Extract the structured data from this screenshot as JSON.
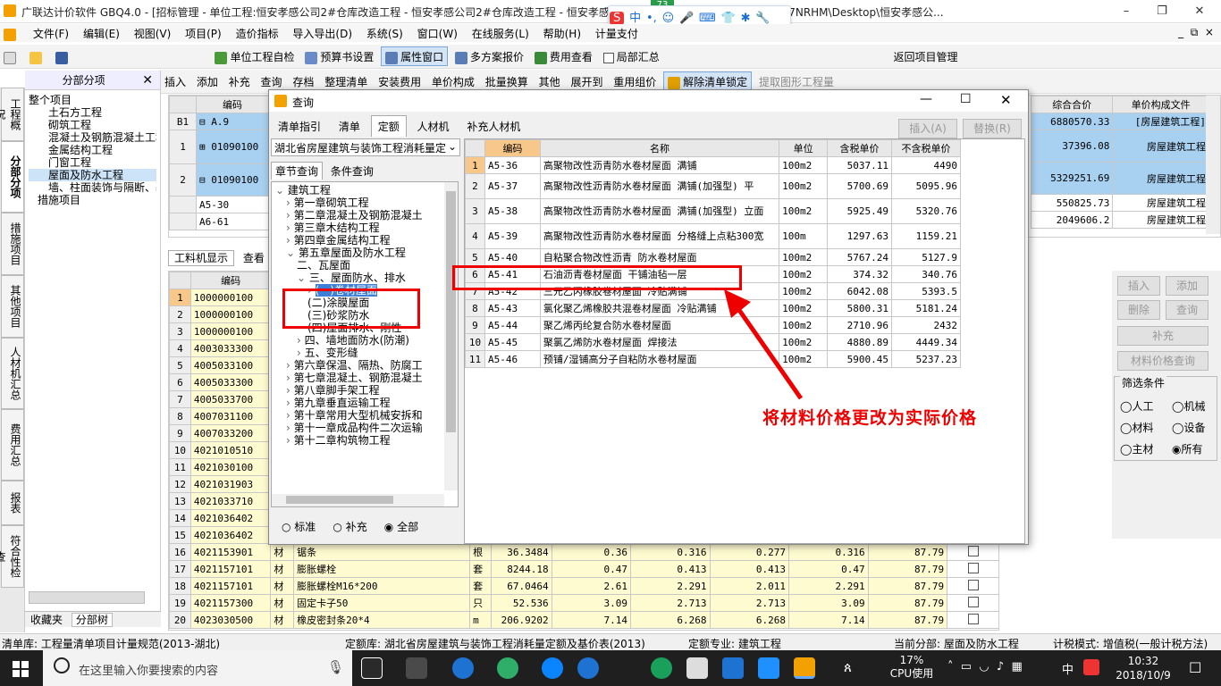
{
  "window": {
    "title": "广联达计价软件 GBQ4.0 - [招标管理 - 单位工程:恒安孝感公司2#仓库改造工程 - 恒安孝感公司2#仓库改造工程 - 恒安孝感公 ...rs\\Administrator.PC-20141127NRHM\\Desktop\\恒安孝感公...",
    "minimize": "–",
    "restore": "❐",
    "close": "✕",
    "badge": "73"
  },
  "ime": {
    "logo": "S",
    "label": "中"
  },
  "menu": [
    "文件(F)",
    "编辑(E)",
    "视图(V)",
    "项目(P)",
    "造价指标",
    "导入导出(D)",
    "系统(S)",
    "窗口(W)",
    "在线服务(L)",
    "帮助(H)",
    "计量支付"
  ],
  "toolbar1": {
    "check": "单位工程自检",
    "budget": "预算书设置",
    "attr": "属性窗口",
    "multi": "多方案报价",
    "fee": "费用查看",
    "local": "局部汇总",
    "back": "返回项目管理"
  },
  "toolbar2": {
    "items": [
      "插入",
      "添加",
      "补充",
      "查询",
      "存档",
      "整理清单",
      "安装费用",
      "单价构成",
      "批量换算",
      "其他",
      "展开到",
      "重用组价",
      "解除清单锁定",
      "提取图形工程量"
    ]
  },
  "lefttabs": [
    "工程概况",
    "分部分项",
    "措施项目",
    "其他项目",
    "人材机汇总",
    "费用汇总",
    "报表",
    "符合性检查"
  ],
  "tree": {
    "header": "分部分项",
    "root": "整个项目",
    "items": [
      "土石方工程",
      "砌筑工程",
      "混凝土及钢筋混凝土工程",
      "金属结构工程",
      "门窗工程",
      "屋面及防水工程",
      "墙、柱面装饰与隔断、幕墙",
      "措施项目"
    ],
    "bottom_tabs": [
      "收藏夹",
      "分部树"
    ]
  },
  "topgrid": {
    "headers": [
      "编码",
      "综合合价",
      "单价构成文件"
    ],
    "rows": [
      [
        "B1",
        "A.9",
        "6880570.33",
        "[房屋建筑工程]"
      ],
      [
        "1",
        "01090100",
        "37396.08",
        "房屋建筑工程"
      ],
      [
        "2",
        "01090100",
        "5329251.69",
        "房屋建筑工程"
      ],
      [
        "",
        "A5-30",
        "550825.73",
        "房屋建筑工程"
      ],
      [
        "",
        "A6-61",
        "2049606.2",
        "房屋建筑工程"
      ]
    ]
  },
  "midtabs": [
    "工料机显示",
    "查看"
  ],
  "bottomgrid": {
    "header": "编码",
    "rows": [
      [
        "1",
        "1000000100"
      ],
      [
        "2",
        "1000000100"
      ],
      [
        "3",
        "1000000100"
      ],
      [
        "4",
        "4003033300"
      ],
      [
        "5",
        "4005033100"
      ],
      [
        "6",
        "4005033300"
      ],
      [
        "7",
        "4005033700"
      ],
      [
        "8",
        "4007031100"
      ],
      [
        "9",
        "4007033200"
      ],
      [
        "10",
        "4021010510"
      ],
      [
        "11",
        "4021030100"
      ],
      [
        "12",
        "4021031903"
      ],
      [
        "13",
        "4021033710"
      ],
      [
        "14",
        "4021036402"
      ],
      [
        "15",
        "4021036402"
      ],
      [
        "16",
        "4021153901",
        "材",
        "锯条",
        "根",
        "36.3484",
        "0.36",
        "0.316",
        "0.277",
        "0.316",
        "87.79"
      ],
      [
        "17",
        "4021157101",
        "材",
        "膨胀螺栓",
        "套",
        "8244.18",
        "0.47",
        "0.413",
        "0.413",
        "0.47",
        "87.79"
      ],
      [
        "18",
        "4021157101",
        "材",
        "膨胀螺栓M16*200",
        "套",
        "67.0464",
        "2.61",
        "2.291",
        "2.011",
        "2.291",
        "87.79"
      ],
      [
        "19",
        "4021157300",
        "材",
        "固定卡子50",
        "只",
        "52.536",
        "3.09",
        "2.713",
        "2.713",
        "3.09",
        "87.79"
      ],
      [
        "20",
        "4023030500",
        "材",
        "橡皮密封条20*4",
        "m",
        "206.9202",
        "7.14",
        "6.268",
        "6.268",
        "7.14",
        "87.79"
      ]
    ]
  },
  "rightpanel": {
    "insert": "插入",
    "add": "添加",
    "delete": "删除",
    "query": "查询",
    "supplement": "补充",
    "price_query": "材料价格查询",
    "filter_title": "筛选条件",
    "filters": [
      "人工",
      "机械",
      "材料",
      "设备",
      "主材",
      "所有"
    ],
    "selected": "所有"
  },
  "dialog": {
    "title": "查询",
    "tabs": [
      "清单指引",
      "清单",
      "定额",
      "人材机",
      "补充人材机"
    ],
    "active_tab": "定额",
    "insert": "插入(A)",
    "replace": "替换(R)",
    "quota_lib": "湖北省房屋建筑与装饰工程消耗量定",
    "search_tabs": [
      "章节查询",
      "条件查询"
    ],
    "chapters": [
      "建筑工程",
      "第一章砌筑工程",
      "第二章混凝土及钢筋混凝土",
      "第三章木结构工程",
      "第四章金属结构工程",
      "第五章屋面及防水工程",
      "二、瓦屋面",
      "三、屋面防水、排水",
      "(一)卷材屋面",
      "(二)涂膜屋面",
      "(三)砂浆防水",
      "(四)屋面排水、刚性",
      "四、墙地面防水(防潮)",
      "五、变形缝",
      "第六章保温、隔热、防腐工",
      "第七章混凝土、钢筋混凝土",
      "第八章脚手架工程",
      "第九章垂直运输工程",
      "第十章常用大型机械安拆和",
      "第十一章成品构件二次运输",
      "第十二章构筑物工程"
    ],
    "radio": [
      "标准",
      "补充",
      "全部"
    ],
    "radio_selected": "全部",
    "headers": [
      "编码",
      "名称",
      "单位",
      "含税单价",
      "不含税单价"
    ],
    "rows": [
      [
        "1",
        "A5-36",
        "高聚物改性沥青防水卷材屋面 满铺",
        "100m2",
        "5037.11",
        "4490"
      ],
      [
        "2",
        "A5-37",
        "高聚物改性沥青防水卷材屋面 满铺(加强型) 平",
        "100m2",
        "5700.69",
        "5095.96"
      ],
      [
        "3",
        "A5-38",
        "高聚物改性沥青防水卷材屋面 满铺(加强型) 立面",
        "100m2",
        "5925.49",
        "5320.76"
      ],
      [
        "4",
        "A5-39",
        "高聚物改性沥青防水卷材屋面 分格缝上点粘300宽",
        "100m",
        "1297.63",
        "1159.21"
      ],
      [
        "5",
        "A5-40",
        "自粘聚合物改性沥青 防水卷材屋面",
        "100m2",
        "5767.24",
        "5127.9"
      ],
      [
        "6",
        "A5-41",
        "石油沥青卷材屋面 干铺油毡一层",
        "100m2",
        "374.32",
        "340.76"
      ],
      [
        "7",
        "A5-42",
        "三元乙丙橡胶卷材屋面 冷贴满铺",
        "100m2",
        "6042.08",
        "5393.5"
      ],
      [
        "8",
        "A5-43",
        "氯化聚乙烯橡胶共混卷材屋面 冷贴满铺",
        "100m2",
        "5800.31",
        "5181.24"
      ],
      [
        "9",
        "A5-44",
        "聚乙烯丙纶复合防水卷材屋面",
        "100m2",
        "2710.96",
        "2432"
      ],
      [
        "10",
        "A5-45",
        "聚氯乙烯防水卷材屋面 焊接法",
        "100m2",
        "4880.89",
        "4449.34"
      ],
      [
        "11",
        "A5-46",
        "预铺/湿铺高分子自粘防水卷材屋面",
        "100m2",
        "5900.45",
        "5237.23"
      ]
    ]
  },
  "annotation": "将材料价格更改为实际价格",
  "status": {
    "list_lib": "清单库: 工程量清单项目计量规范(2013-湖北)",
    "quota_lib": "定额库: 湖北省房屋建筑与装饰工程消耗量定额及基价表(2013)",
    "major": "定额专业: 建筑工程",
    "current": "当前分部: 屋面及防水工程",
    "tax": "计税模式: 增值税(一般计税方法)"
  },
  "taskbar": {
    "search": "在这里输入你要搜索的内容",
    "cpu": "17%",
    "cpu_label": "CPU使用",
    "ime": "中",
    "time": "10:32",
    "date": "2018/10/9"
  },
  "colors": {
    "accent": "#e00000",
    "select": "#a8d0f0",
    "yellow": "#fffbd0"
  }
}
